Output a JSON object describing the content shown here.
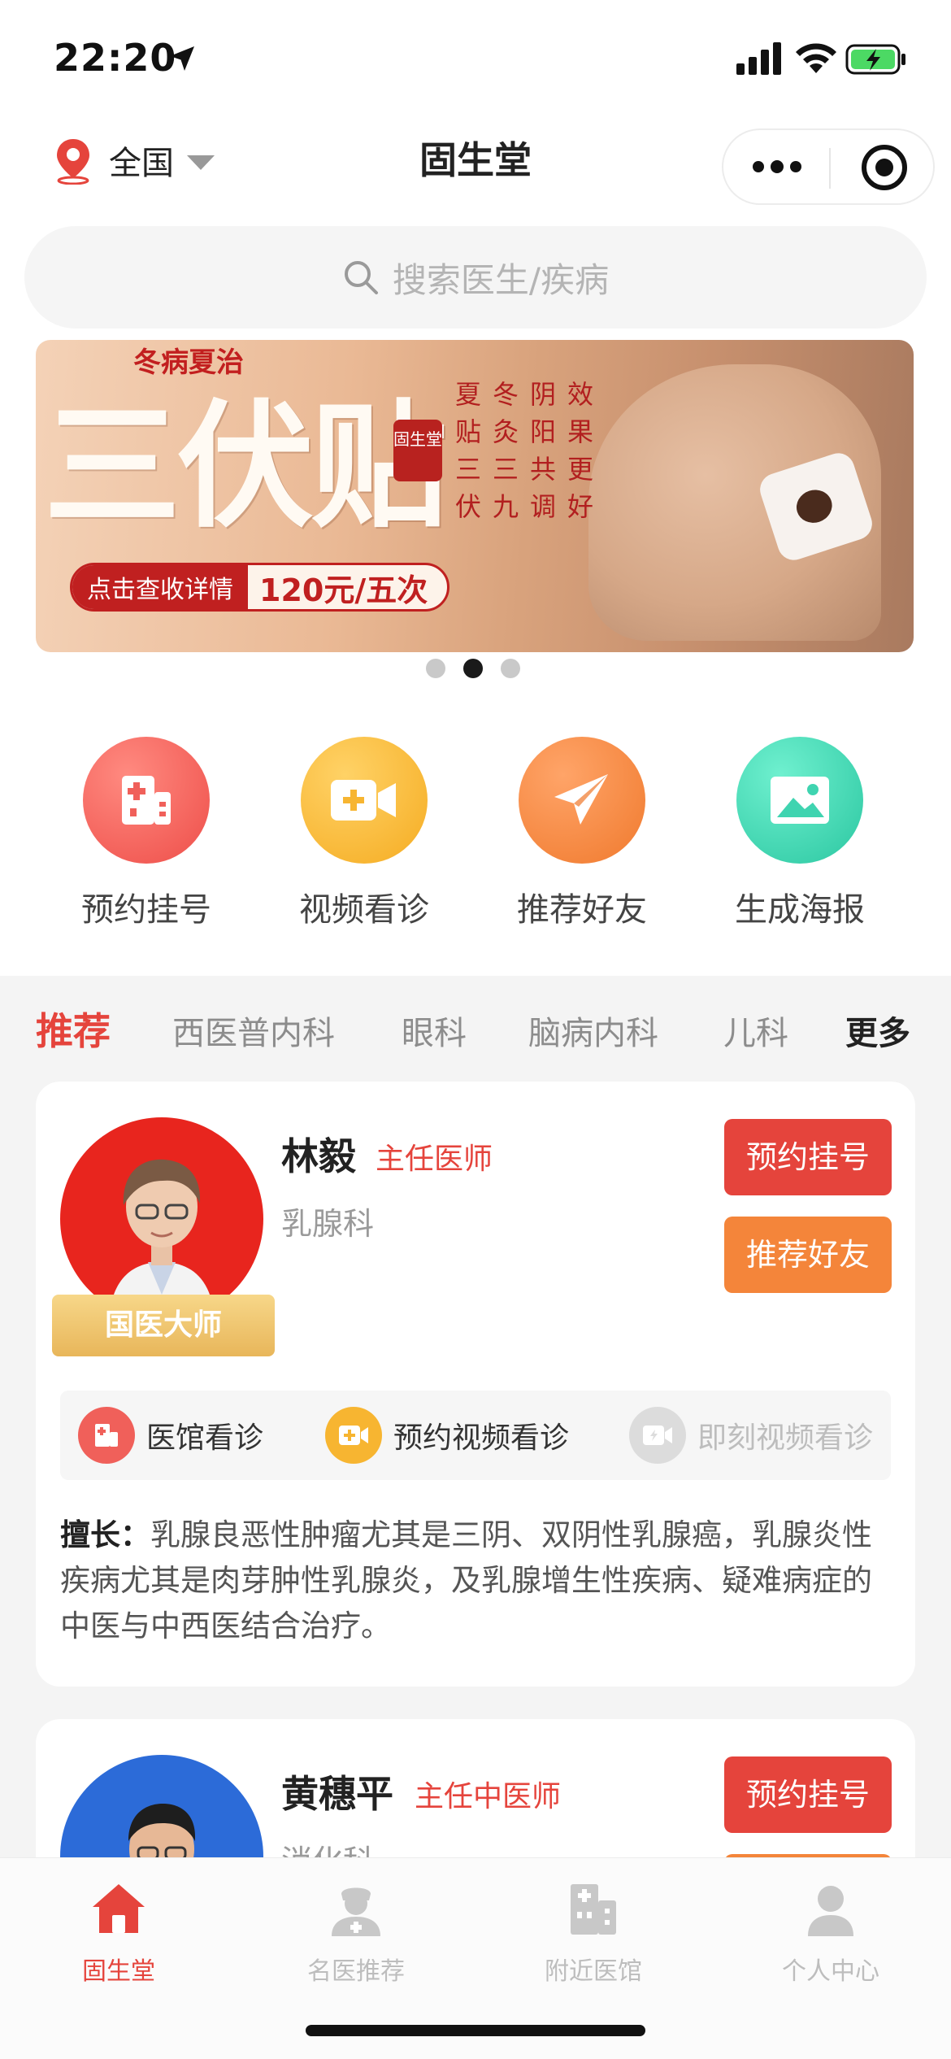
{
  "status_bar": {
    "time": "22:20"
  },
  "navbar": {
    "location": "全国",
    "title": "固生堂"
  },
  "search": {
    "placeholder": "搜索医生/疾病"
  },
  "banner": {
    "top_text": "冬病夏治",
    "main_text": "三伏贴",
    "seal_text": "固生堂",
    "columns": [
      [
        "夏",
        "贴",
        "三",
        "伏"
      ],
      [
        "冬",
        "灸",
        "三",
        "九"
      ],
      [
        "阴",
        "阳",
        "共",
        "调"
      ],
      [
        "效",
        "果",
        "更",
        "好"
      ]
    ],
    "pill_left": "点击查收详情",
    "pill_right": "120元/五次",
    "dots": 3,
    "active_dot": 1
  },
  "quick_actions": [
    {
      "label": "预约挂号",
      "icon": "hospital-icon",
      "color": "#f0605a"
    },
    {
      "label": "视频看诊",
      "icon": "video-icon",
      "color": "#f7b531"
    },
    {
      "label": "推荐好友",
      "icon": "paper-plane-icon",
      "color": "#f4853a"
    },
    {
      "label": "生成海报",
      "icon": "image-icon",
      "color": "#3fd4b0"
    }
  ],
  "tabs": [
    {
      "label": "推荐",
      "active": true
    },
    {
      "label": "西医普内科"
    },
    {
      "label": "眼科"
    },
    {
      "label": "脑病内科"
    },
    {
      "label": "儿科"
    },
    {
      "label": "更多"
    }
  ],
  "doctors": [
    {
      "name": "林毅",
      "title": "主任医师",
      "department": "乳腺科",
      "badge": "国医大师",
      "book_label": "预约挂号",
      "recommend_label": "推荐好友",
      "services": [
        {
          "label": "医馆看诊",
          "enabled": true
        },
        {
          "label": "预约视频看诊",
          "enabled": true
        },
        {
          "label": "即刻视频看诊",
          "enabled": false
        }
      ],
      "expertise_label": "擅长：",
      "expertise": "乳腺良恶性肿瘤尤其是三阴、双阴性乳腺癌，乳腺炎性疾病尤其是肉芽肿性乳腺炎，及乳腺增生性疾病、疑难病症的中医与中西医结合治疗。"
    },
    {
      "name": "黄穗平",
      "title": "主任中医师",
      "department": "消化科",
      "book_label": "预约挂号"
    }
  ],
  "tabbar": [
    {
      "label": "固生堂",
      "icon": "home-icon",
      "active": true
    },
    {
      "label": "名医推荐",
      "icon": "doctor-icon"
    },
    {
      "label": "附近医馆",
      "icon": "building-icon"
    },
    {
      "label": "个人中心",
      "icon": "user-icon"
    }
  ],
  "colors": {
    "accent": "#e5443c",
    "orange": "#f4853a",
    "gold": "#e8b65a"
  }
}
